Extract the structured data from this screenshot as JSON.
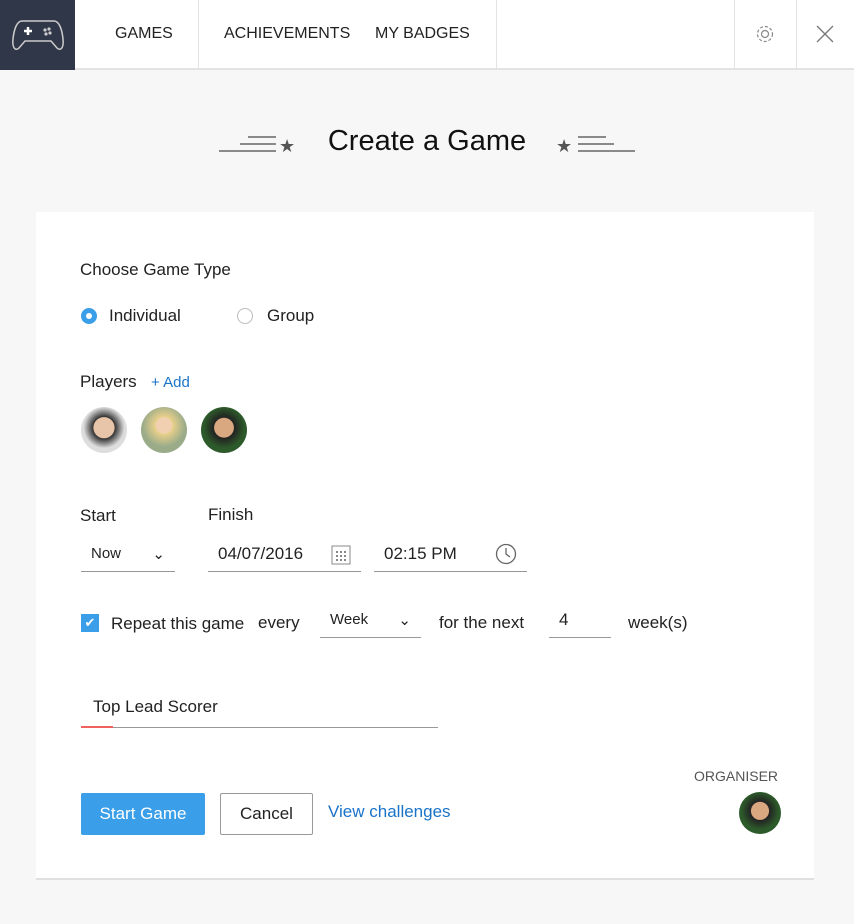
{
  "nav": {
    "games": "GAMES",
    "achievements": "ACHIEVEMENTS",
    "badges": "MY BADGES"
  },
  "page_title": "Create a Game",
  "form": {
    "game_type_label": "Choose Game Type",
    "individual": "Individual",
    "group": "Group",
    "selected_type": "Individual",
    "players_label": "Players",
    "add_label": "+ Add",
    "start_label": "Start",
    "finish_label": "Finish",
    "start_value": "Now",
    "finish_date": "04/07/2016",
    "finish_time": "02:15 PM",
    "repeat_label": "Repeat this game",
    "every_label": "every",
    "repeat_checked": true,
    "interval": "Week",
    "for_next": "for the next",
    "count": "4",
    "unit": "week(s)",
    "game_name": "Top Lead Scorer",
    "organiser_label": "ORGANISER"
  },
  "buttons": {
    "start": "Start Game",
    "cancel": "Cancel",
    "view": "View challenges"
  },
  "colors": {
    "accent": "#3a9fe8",
    "logo_bg": "#303749",
    "link": "#1a73c8",
    "error": "#f0625d"
  }
}
